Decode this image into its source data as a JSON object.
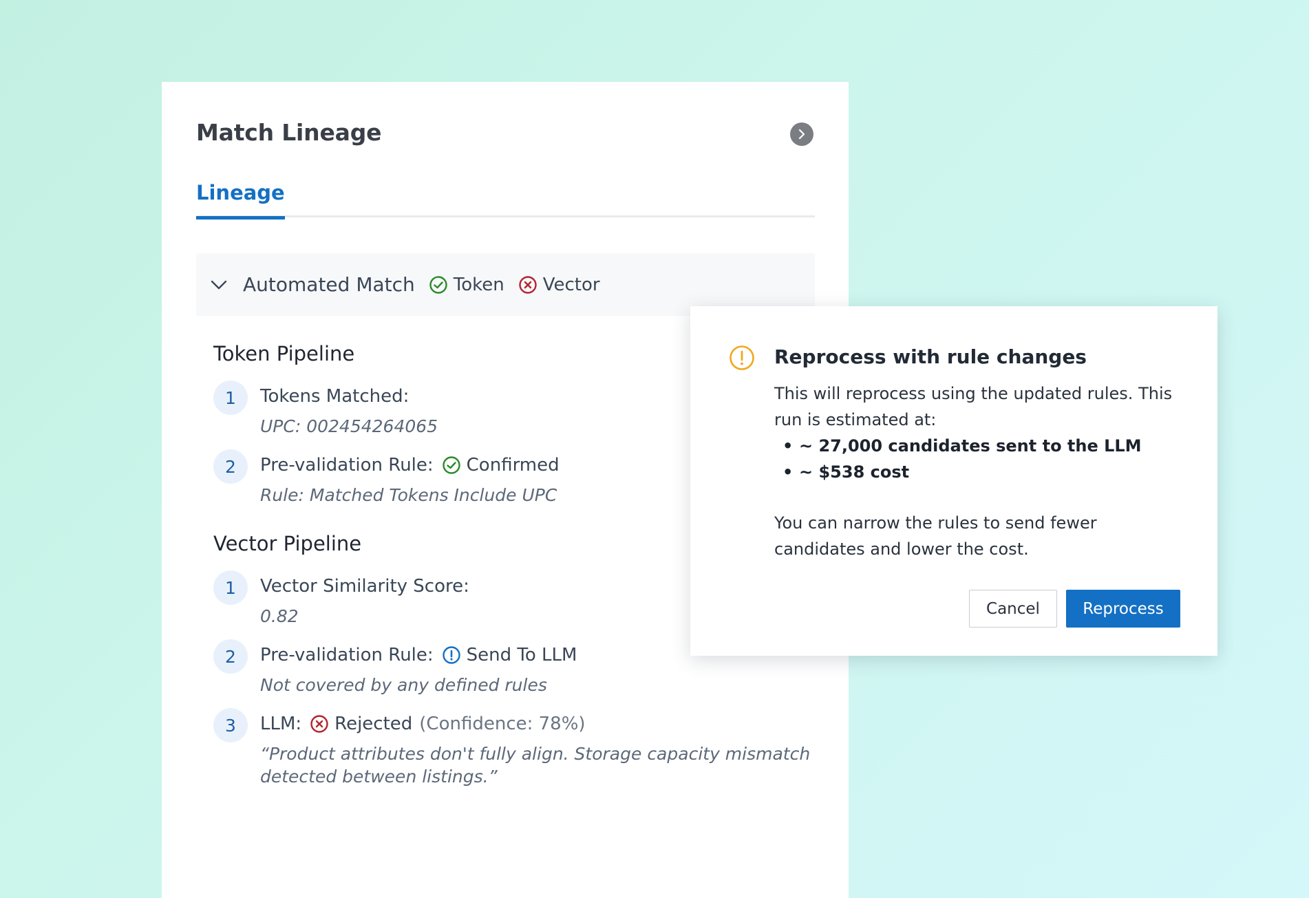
{
  "panel": {
    "title": "Match Lineage",
    "tabs": [
      {
        "label": "Lineage",
        "active": true
      }
    ]
  },
  "section": {
    "label": "Automated Match",
    "statuses": [
      {
        "label": "Token",
        "state": "check-circle-icon",
        "color": "#2a8a2a"
      },
      {
        "label": "Vector",
        "state": "x-circle-icon",
        "color": "#b3262e"
      }
    ]
  },
  "token_pipeline": {
    "title": "Token Pipeline",
    "steps": [
      {
        "num": "1",
        "label": "Tokens Matched:",
        "sub": "UPC: 002454264065"
      },
      {
        "num": "2",
        "label": "Pre-validation Rule:",
        "status": "Confirmed",
        "sub": "Rule: Matched Tokens Include UPC"
      }
    ]
  },
  "vector_pipeline": {
    "title": "Vector Pipeline",
    "steps": [
      {
        "num": "1",
        "label": "Vector Similarity Score:",
        "sub": "0.82"
      },
      {
        "num": "2",
        "label": "Pre-validation Rule:",
        "status": "Send To LLM",
        "sub": "Not covered by any defined rules"
      },
      {
        "num": "3",
        "label": "LLM:",
        "status": "Rejected",
        "extra": "(Confidence: 78%)",
        "sub": "“Product attributes don't fully align. Storage capacity mismatch detected between listings.”"
      }
    ]
  },
  "modal": {
    "title": "Reprocess with rule changes",
    "intro": "This will reprocess using the updated rules. This run is estimated at:",
    "bullets": [
      "~ 27,000 candidates sent to the LLM",
      "~ $538 cost"
    ],
    "note": "You can narrow the rules to send fewer candidates and lower the cost.",
    "cancel_label": "Cancel",
    "confirm_label": "Reprocess"
  },
  "colors": {
    "accent": "#1470c4",
    "success": "#2a8a2a",
    "error": "#b3262e",
    "warning": "#f0a81c",
    "info": "#1470c4"
  }
}
